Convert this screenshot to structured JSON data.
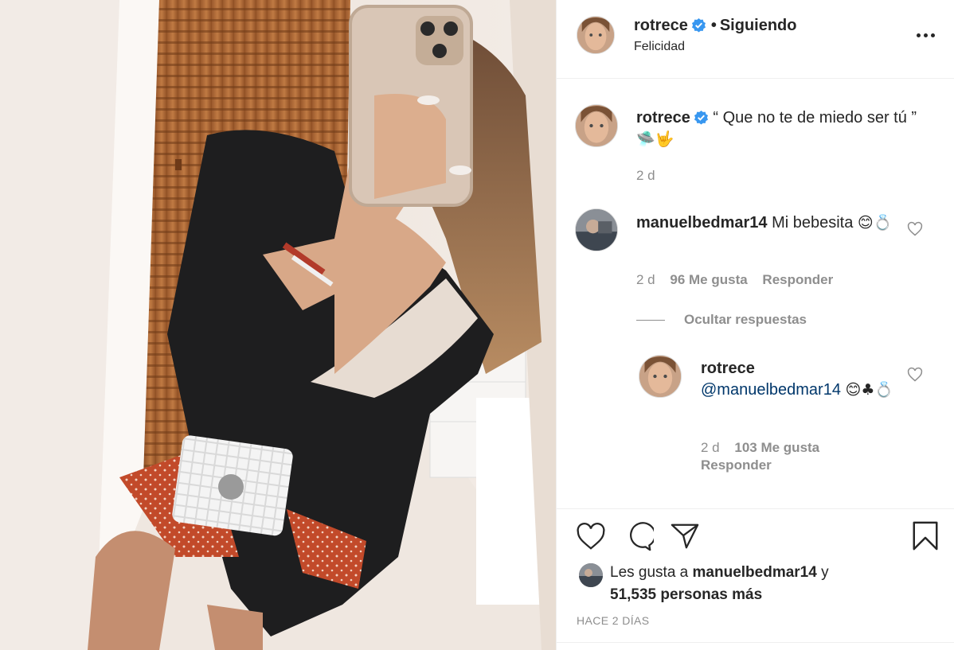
{
  "post": {
    "username": "rotrece",
    "separator": "•",
    "follow_status": "Siguiendo",
    "location": "Felicidad"
  },
  "caption": {
    "username": "rotrece",
    "text": "“ Que no te de miedo ser tú ”",
    "emojis": "🛸🤟",
    "time": "2 d"
  },
  "comment": {
    "username": "manuelbedmar14",
    "text": "Mi bebesita",
    "emojis": "😊💍",
    "time": "2 d",
    "likes": "96 Me gusta",
    "reply_label": "Responder",
    "hide_replies": "Ocultar respuestas"
  },
  "reply": {
    "username": "rotrece",
    "mention": "@manuelbedmar14",
    "emojis": "😊♣💍",
    "time": "2 d",
    "likes": "103 Me gusta",
    "reply_label": "Responder"
  },
  "likes": {
    "prefix": "Les gusta a",
    "user": "manuelbedmar14",
    "conj": "y",
    "count": "51,535 personas más"
  },
  "timestamp": "HACE 2 DÍAS",
  "icons": {
    "like": "heart-icon",
    "comment": "comment-bubble-icon",
    "share": "paper-plane-icon",
    "save": "bookmark-icon",
    "more": "more-options-icon",
    "verified": "verified-badge-icon"
  },
  "colors": {
    "text": "#262626",
    "muted": "#8e8e8e",
    "verified": "#3897f0",
    "link": "#00376b"
  }
}
